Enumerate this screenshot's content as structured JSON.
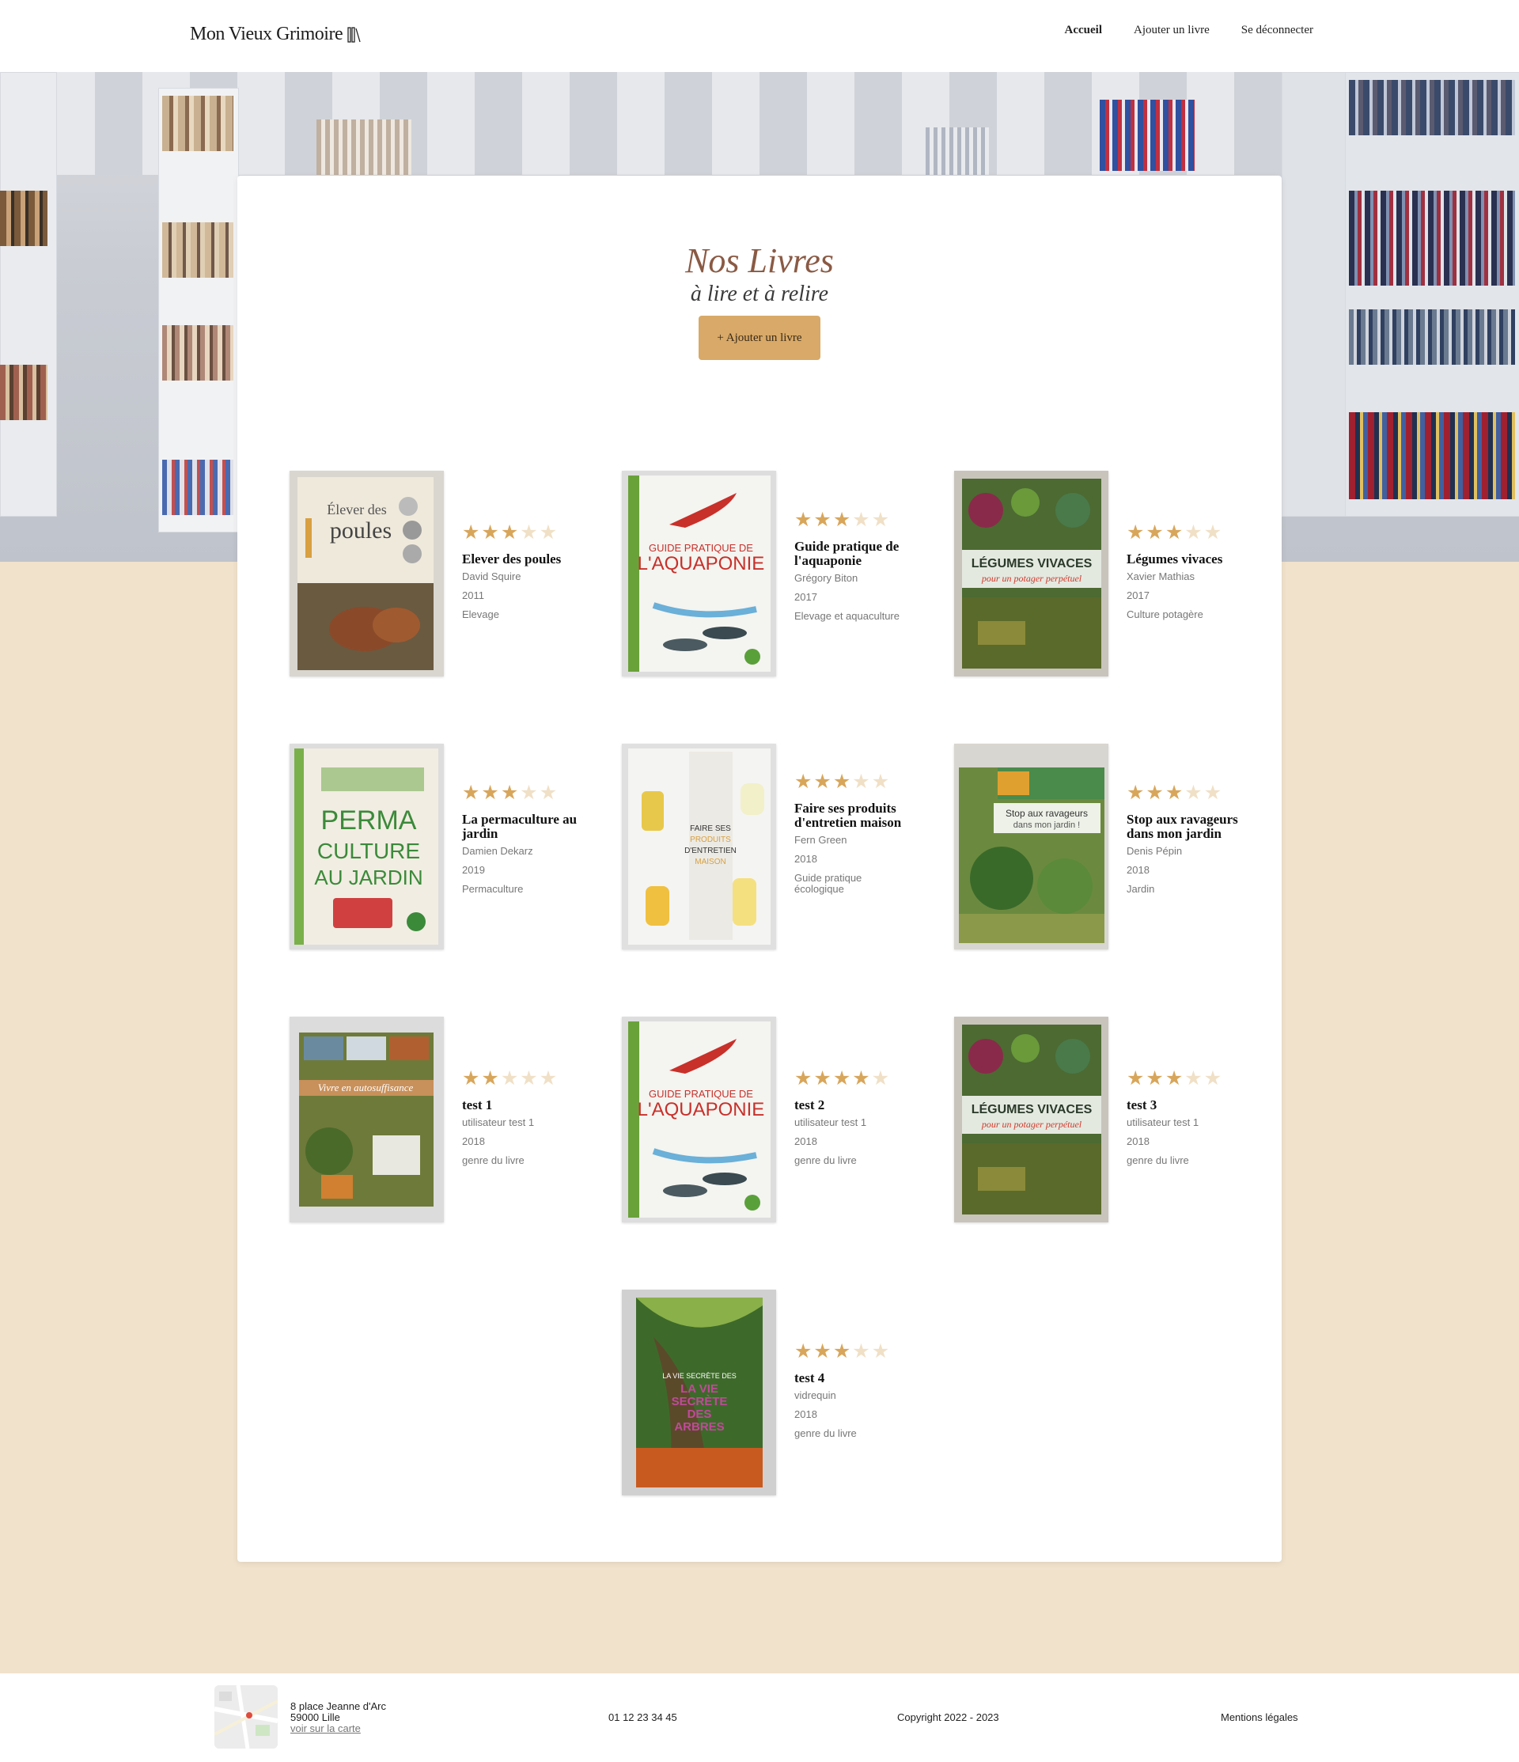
{
  "header": {
    "logo_text": "Mon Vieux Grimoire",
    "nav": [
      {
        "label": "Accueil",
        "active": true
      },
      {
        "label": "Ajouter un livre",
        "active": false
      },
      {
        "label": "Se déconnecter",
        "active": false
      }
    ]
  },
  "main": {
    "title": "Nos Livres",
    "subtitle": "à lire et à relire",
    "add_button": "+ Ajouter un livre"
  },
  "books": [
    {
      "title": "Elever des poules",
      "author": "David Squire",
      "year": "2011",
      "genre": "Elevage",
      "rating": 3
    },
    {
      "title": "Guide pratique de l'aquaponie",
      "author": "Grégory Biton",
      "year": "2017",
      "genre": "Elevage et aquaculture",
      "rating": 3
    },
    {
      "title": "Légumes vivaces",
      "author": "Xavier Mathias",
      "year": "2017",
      "genre": "Culture potagère",
      "rating": 3
    },
    {
      "title": "La permaculture au jardin",
      "author": "Damien Dekarz",
      "year": "2019",
      "genre": "Permaculture",
      "rating": 3
    },
    {
      "title": "Faire ses produits d'entretien maison",
      "author": "Fern Green",
      "year": "2018",
      "genre": "Guide pratique écologique",
      "rating": 3
    },
    {
      "title": "Stop aux ravageurs dans mon jardin",
      "author": "Denis Pépin",
      "year": "2018",
      "genre": "Jardin",
      "rating": 3
    },
    {
      "title": "test 1",
      "author": "utilisateur test 1",
      "year": "2018",
      "genre": "genre du livre",
      "rating": 2
    },
    {
      "title": "test 2",
      "author": "utilisateur test 1",
      "year": "2018",
      "genre": "genre du livre",
      "rating": 4
    },
    {
      "title": "test 3",
      "author": "utilisateur test 1",
      "year": "2018",
      "genre": "genre du livre",
      "rating": 3
    },
    {
      "title": "test 4",
      "author": "vidrequin",
      "year": "2018",
      "genre": "genre du livre",
      "rating": 3
    }
  ],
  "covers": [
    {
      "text_top": "Élever des",
      "text_main": "poules",
      "bg": "#efe9dc",
      "accent": "#8a6a3a",
      "style": "poules"
    },
    {
      "text_top": "GUIDE PRATIQUE DE",
      "text_main": "L'AQUAPONIE",
      "bg": "#f4f4f0",
      "accent": "#c8302a",
      "style": "aqua"
    },
    {
      "text_top": "LÉGUMES VIVACES",
      "text_main": "pour un potager perpétuel",
      "bg": "#4c6a32",
      "accent": "#d0392b",
      "style": "legumes"
    },
    {
      "text_top": "PERMA",
      "text_main": "CULTURE AU JARDIN",
      "bg": "#f1ede2",
      "accent": "#3b8a3a",
      "style": "perma"
    },
    {
      "text_top": "FAIRE SES PRODUITS",
      "text_main": "D'ENTRETIEN MAISON",
      "bg": "#f4f4f2",
      "accent": "#e8c84a",
      "style": "entretien"
    },
    {
      "text_top": "Stop aux ravageurs",
      "text_main": "dans mon jardin !",
      "bg": "#6b8a3f",
      "accent": "#e0a030",
      "style": "stop"
    },
    {
      "text_top": "Vivre en autosuffisance",
      "text_main": "",
      "bg": "#6e7a3a",
      "accent": "#d89a4a",
      "style": "auto"
    },
    {
      "text_top": "GUIDE PRATIQUE DE",
      "text_main": "L'AQUAPONIE",
      "bg": "#f4f4f0",
      "accent": "#c8302a",
      "style": "aqua"
    },
    {
      "text_top": "LÉGUMES VIVACES",
      "text_main": "pour un potager perpétuel",
      "bg": "#4c6a32",
      "accent": "#d0392b",
      "style": "legumes"
    },
    {
      "text_top": "LA VIE SECRÈTE DES",
      "text_main": "ARBRES",
      "bg": "#3d6a2a",
      "accent": "#c04a9a",
      "style": "arbres"
    }
  ],
  "footer": {
    "address_line1": "8 place Jeanne d'Arc",
    "address_line2": "59000 Lille",
    "map_link": "voir sur la carte",
    "phone": "01 12 23 34 45",
    "copyright": "Copyright 2022 - 2023",
    "legal": "Mentions légales"
  },
  "colors": {
    "accent": "#d8a968",
    "star_on": "#d8a65b",
    "star_off": "#f0e0c6",
    "page_bg": "#f1e2cc"
  }
}
